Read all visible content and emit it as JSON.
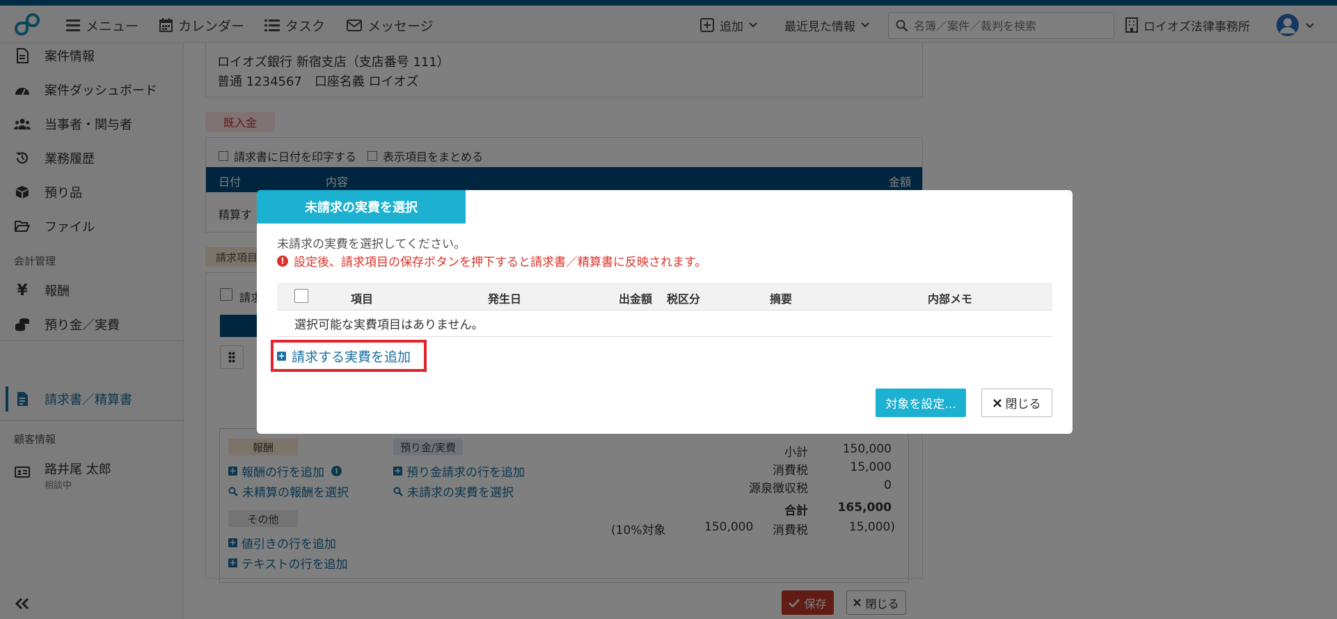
{
  "topbar": {
    "menu": "メニュー",
    "calendar": "カレンダー",
    "task": "タスク",
    "message": "メッセージ",
    "add": "追加",
    "recent": "最近見た情報",
    "search_placeholder": "名簿／案件／裁判を検索",
    "office": "ロイオズ法律事務所"
  },
  "sidebar": {
    "items": [
      {
        "label": "案件情報"
      },
      {
        "label": "案件ダッシュボード"
      },
      {
        "label": "当事者・関与者"
      },
      {
        "label": "業務履歴"
      },
      {
        "label": "預り品"
      },
      {
        "label": "ファイル"
      }
    ],
    "section_accounting": "会計管理",
    "accounting": [
      {
        "label": "報酬"
      },
      {
        "label": "預り金／実費"
      },
      {
        "label": "請求書／精算書"
      }
    ],
    "section_client": "顧客情報",
    "client_name": "路井尾 太郎",
    "client_status": "相談中"
  },
  "bank": {
    "line1": "ロイオズ銀行 新宿支店（支店番号 111）",
    "line2": "普通 1234567　口座名義 ロイオズ"
  },
  "received": {
    "badge": "既入金",
    "print_date": "請求書に日付を印字する",
    "group_items": "表示項目をまとめる",
    "col_date": "日付",
    "col_content": "内容",
    "col_amount": "金額",
    "row_text": "精算す"
  },
  "items": {
    "badge": "請求項目",
    "partial_label": "請求"
  },
  "summary": {
    "tag_fee": "報酬",
    "tag_deposit": "預り金/実費",
    "tag_other": "その他",
    "add_fee_row": "報酬の行を追加",
    "select_unsettled_fee": "未精算の報酬を選択",
    "add_deposit_row": "預り金請求の行を追加",
    "select_unbilled_expense": "未請求の実費を選択",
    "add_discount_row": "値引きの行を追加",
    "add_text_row": "テキストの行を追加",
    "subtotal_label": "小計",
    "subtotal_value": "150,000",
    "tax_label": "消費税",
    "tax_value": "15,000",
    "withholding_label": "源泉徴収税",
    "withholding_value": "0",
    "total_label": "合計",
    "total_value": "165,000",
    "breakdown_prefix": "(10%対象",
    "breakdown_base": "150,000",
    "breakdown_tax_label": "消費税",
    "breakdown_tax_value": "15,000)"
  },
  "footer": {
    "save": "保存",
    "close": "閉じる"
  },
  "modal": {
    "title": "未請求の実費を選択",
    "desc": "未請求の実費を選択してください。",
    "warning": "設定後、請求項目の保存ボタンを押下すると請求書／精算書に反映されます。",
    "columns": {
      "item": "項目",
      "date": "発生日",
      "amount": "出金額",
      "tax": "税区分",
      "summary": "摘要",
      "memo": "内部メモ"
    },
    "empty": "選択可能な実費項目はありません。",
    "add_expense": "請求する実費を追加",
    "apply": "対象を設定...",
    "close": "閉じる"
  },
  "colors": {
    "primary": "#1a6fa0",
    "accent": "#1cb1d0",
    "danger": "#d9342b",
    "header_dark": "#004b7c"
  }
}
